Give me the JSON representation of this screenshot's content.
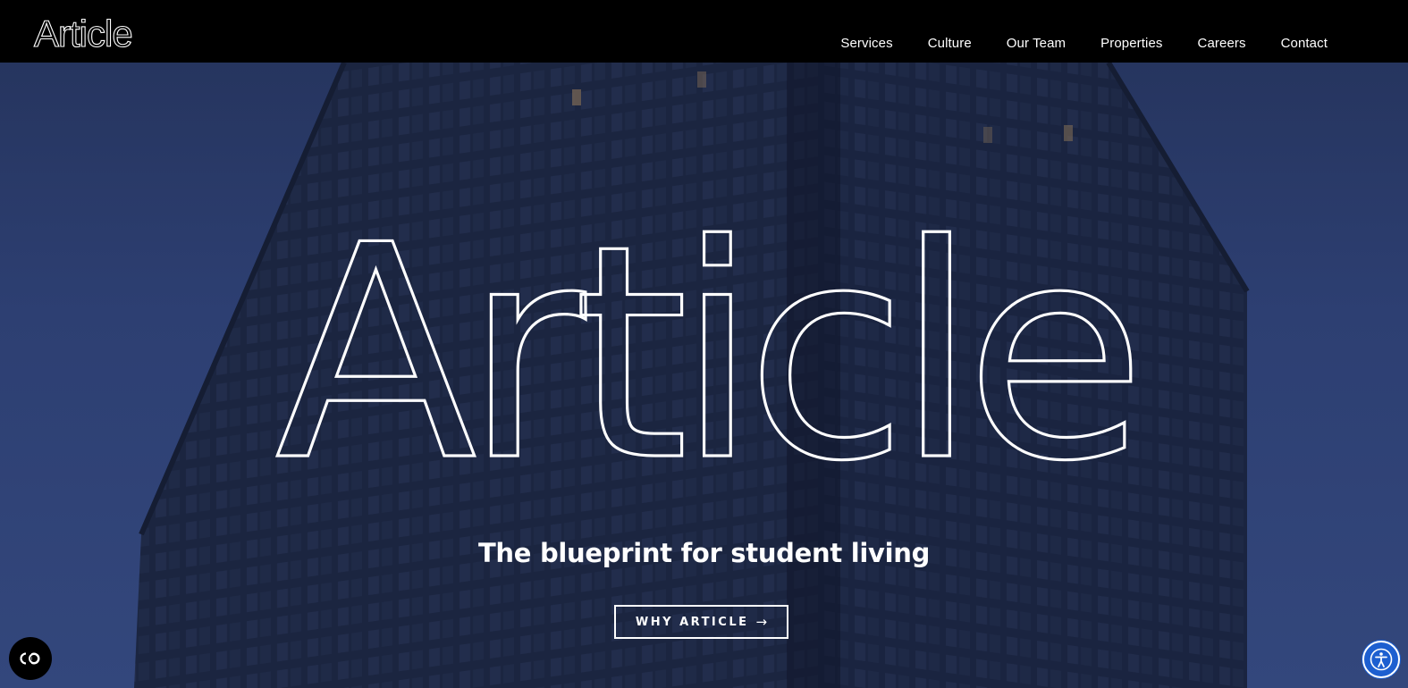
{
  "brand": {
    "name": "Article"
  },
  "nav": {
    "items": [
      {
        "label": "Services"
      },
      {
        "label": "Culture"
      },
      {
        "label": "Our Team"
      },
      {
        "label": "Properties"
      },
      {
        "label": "Careers"
      },
      {
        "label": "Contact"
      }
    ]
  },
  "hero": {
    "word": "Article",
    "tagline": "The blueprint for student living",
    "cta_label": "WHY ARTICLE",
    "cta_arrow": "→"
  },
  "widgets": {
    "cookie_icon": "cookie-preferences-icon",
    "accessibility_icon": "accessibility-icon"
  },
  "colors": {
    "header_bg": "#000000",
    "sky": "#2d3f72",
    "building": "#1b2540",
    "text": "#ffffff",
    "accessibility_blue": "#1d5fd0"
  }
}
